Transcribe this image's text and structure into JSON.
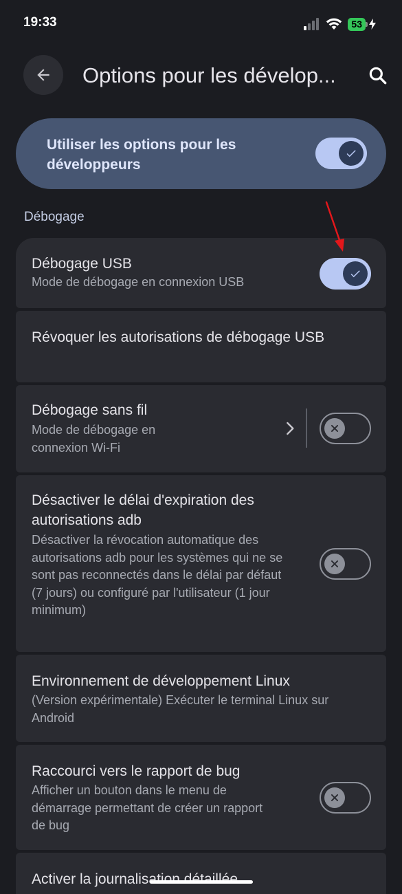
{
  "status": {
    "time": "19:33",
    "battery": "53"
  },
  "app_bar": {
    "title": "Options pour les dévelop..."
  },
  "master": {
    "label": "Utiliser les options pour les développeurs",
    "enabled": true
  },
  "section": {
    "header": "Débogage"
  },
  "rows": [
    {
      "title": "Débogage USB",
      "subtitle": "Mode de débogage en connexion USB",
      "toggle": true
    },
    {
      "title": "Révoquer les autorisations de débogage USB"
    },
    {
      "title": "Débogage sans fil",
      "subtitle": "Mode de débogage en connexion Wi-Fi",
      "toggle": false
    },
    {
      "title": "Désactiver le délai d'expiration des autorisations adb",
      "subtitle": "Désactiver la révocation automatique des autorisations adb pour les systèmes qui ne se sont pas reconnectés dans le délai par défaut (7 jours) ou configuré par l'utilisateur (1 jour minimum)",
      "toggle": false
    },
    {
      "title": "Environnement de développement Linux",
      "subtitle": "(Version expérimentale) Exécuter le terminal Linux sur Android"
    },
    {
      "title": "Raccourci vers le rapport de bug",
      "subtitle": "Afficher un bouton dans le menu de démarrage permettant de créer un rapport de bug",
      "toggle": false
    },
    {
      "title": "Activer la journalisation détaillée"
    }
  ],
  "colors": {
    "background": "#1b1c21",
    "card": "#2a2b31",
    "master_card": "#475672",
    "toggle_on": "#b8c8f3",
    "arrow_annotation": "#e3171b"
  },
  "icons": [
    "back-arrow-icon",
    "search-icon",
    "wifi-icon",
    "signal-icon",
    "battery-icon",
    "check-icon",
    "close-icon",
    "chevron-right-icon"
  ]
}
